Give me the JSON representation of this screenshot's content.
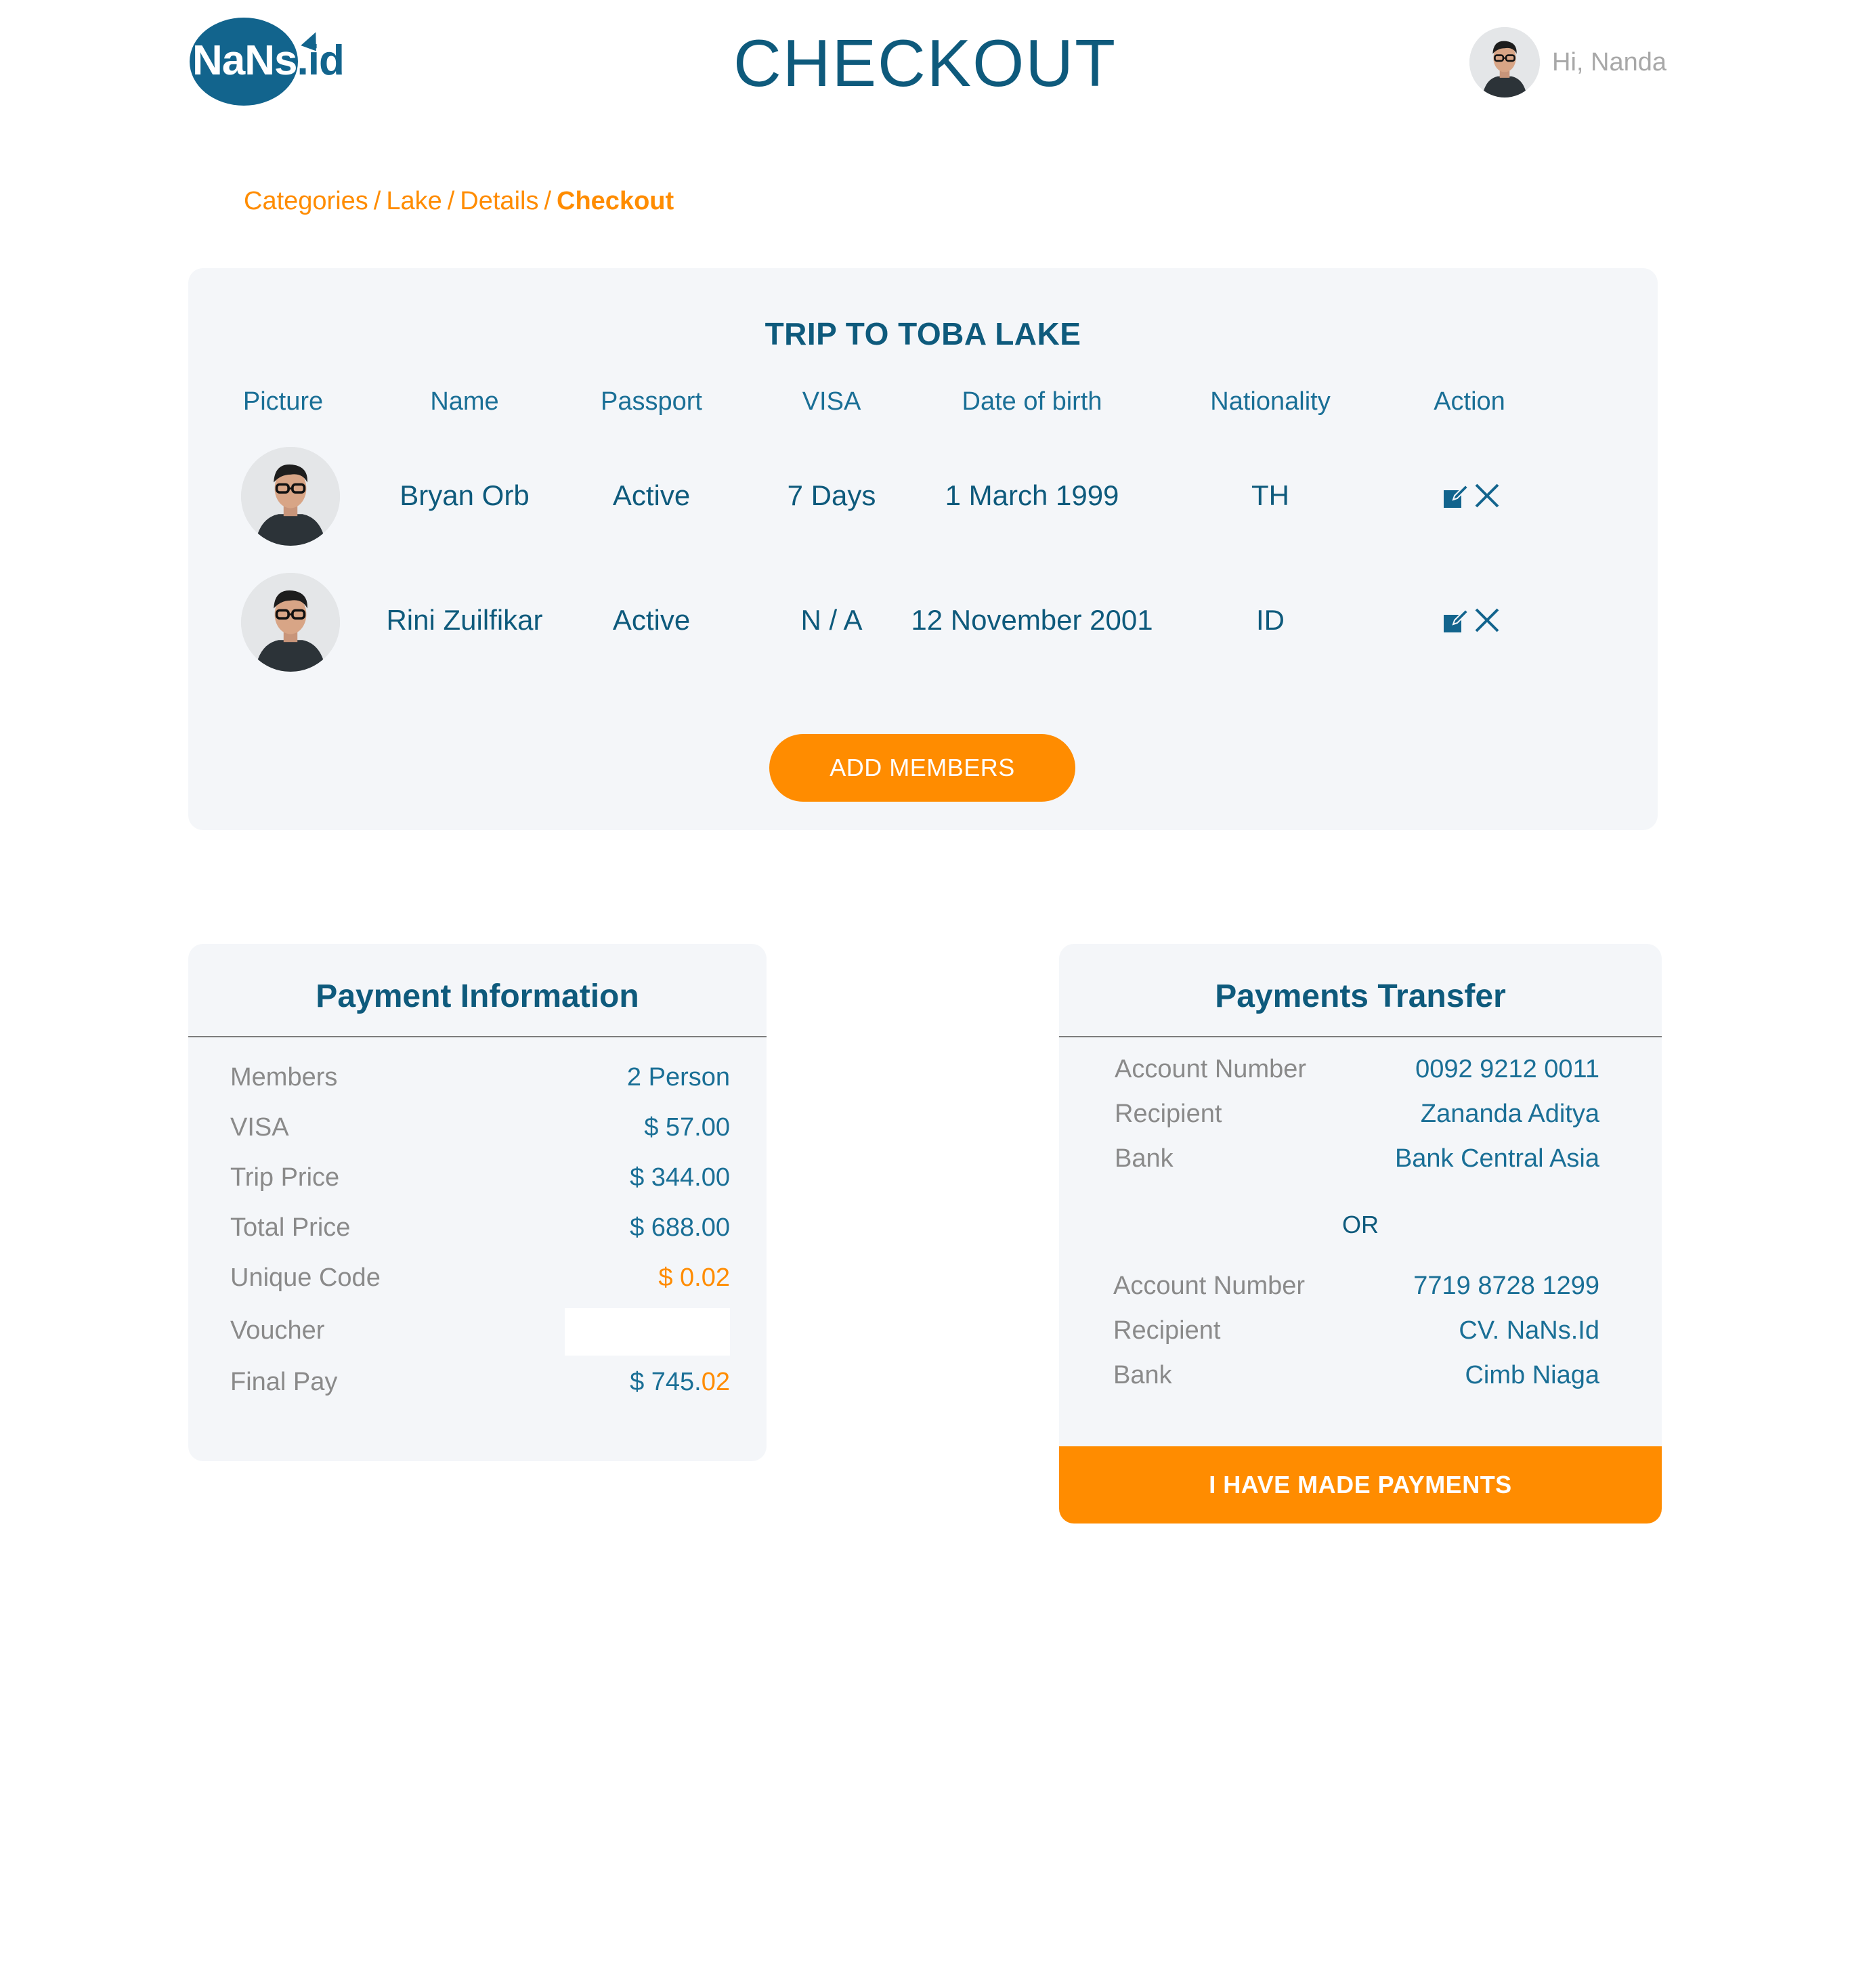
{
  "header": {
    "logo": {
      "text_white": "NaNs",
      "text_dark": ".id"
    },
    "title": "CHECKOUT",
    "user": {
      "greeting": "Hi, Nanda",
      "avatar_icon": "person-avatar"
    }
  },
  "breadcrumb": {
    "items": [
      "Categories",
      "Lake",
      "Details"
    ],
    "separator": "/",
    "current": "Checkout"
  },
  "trip": {
    "title": "TRIP TO TOBA LAKE",
    "columns": [
      "Picture",
      "Name",
      "Passport",
      "VISA",
      "Date of birth",
      "Nationality",
      "Action"
    ],
    "members": [
      {
        "name": "Bryan Orb",
        "passport": "Active",
        "visa": "7 Days",
        "dob": "1 March 1999",
        "nationality": "TH",
        "actions": [
          "edit-icon",
          "delete-icon"
        ]
      },
      {
        "name": "Rini Zuilfikar",
        "passport": "Active",
        "visa": "N / A",
        "dob": "12 November 2001",
        "nationality": "ID",
        "actions": [
          "edit-icon",
          "delete-icon"
        ]
      }
    ],
    "add_button": "ADD MEMBERS"
  },
  "payment_info": {
    "title": "Payment Information",
    "rows": {
      "members": {
        "label": "Members",
        "value": "2 Person"
      },
      "visa": {
        "label": "VISA",
        "value": "$ 57.00"
      },
      "trip_price": {
        "label": "Trip Price",
        "value": "$ 344.00"
      },
      "total_price": {
        "label": "Total Price",
        "value": "$ 688.00"
      },
      "unique_code": {
        "label": "Unique Code",
        "value": "$ 0.02"
      },
      "voucher": {
        "label": "Voucher",
        "value": ""
      },
      "final_pay": {
        "label": "Final Pay",
        "value_main": "$ 745.",
        "value_code": "02"
      }
    }
  },
  "payments_transfer": {
    "title": "Payments Transfer",
    "accounts": [
      {
        "number_label": "Account Number",
        "number": "0092 9212 0011",
        "recipient_label": "Recipient",
        "recipient": "Zananda Aditya",
        "bank_label": "Bank",
        "bank": "Bank Central Asia"
      },
      {
        "number_label": "Account Number",
        "number": "7719 8728 1299",
        "recipient_label": "Recipient",
        "recipient": "CV. NaNs.Id",
        "bank_label": "Bank",
        "bank": "Cimb Niaga"
      }
    ],
    "or_label": "OR",
    "confirm_button": "I HAVE MADE PAYMENTS"
  },
  "colors": {
    "primary": "#0e5a7c",
    "accent": "#ff8c00",
    "panel_bg": "#f4f6f9",
    "muted_text": "#8a8a8a"
  }
}
